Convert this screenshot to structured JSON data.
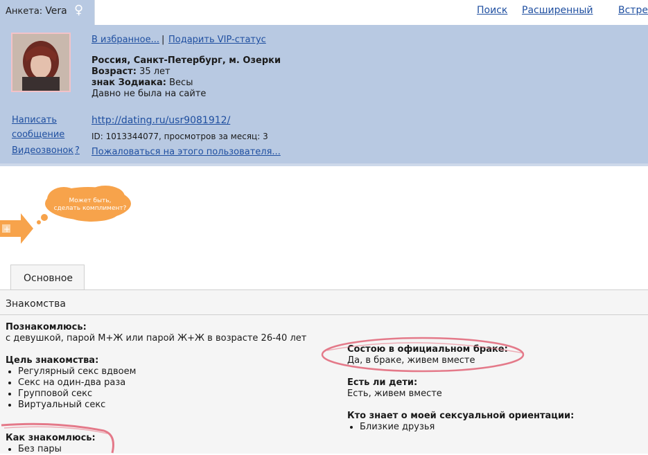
{
  "top": {
    "tab_prefix": "Анкета:",
    "tab_name": "Vera",
    "nav": [
      "Поиск",
      "Расширенный",
      "Встре"
    ]
  },
  "profile": {
    "fav_link": "В избранное...",
    "separator": "|",
    "vip_link": "Подарить VIP-статус",
    "location": "Россия, Санкт-Петербург, м. Озерки",
    "age_label": "Возраст:",
    "age_value": "35 лет",
    "zodiac_label": "знак Зодиака:",
    "zodiac_value": "Весы",
    "last_seen": "Давно не была на сайте",
    "write_1": "Написать",
    "write_2": "сообщение",
    "video": "Видеозвонок",
    "video_help": "?",
    "url": "http://dating.ru/usr9081912/",
    "id_line": "ID: 1013344077, просмотров за месяц: 3",
    "complain": "Пожаловаться на этого пользователя..."
  },
  "compliment": {
    "line1": "Может быть,",
    "line2": "сделать комплимент?"
  },
  "tabs": {
    "main": "Основное"
  },
  "section": {
    "title": "Знакомства",
    "meet_label": "Познакомлюсь:",
    "meet_value": "с девушкой, парой М+Ж или парой Ж+Ж в возрасте 26-40 лет",
    "goal_label": "Цель знакомства:",
    "goals": [
      "Регулярный секс вдвоем",
      "Секс на один-два раза",
      "Групповой секс",
      "Виртуальный секс"
    ],
    "how_label": "Как знакомлюсь:",
    "how": [
      "Без пары"
    ],
    "marriage_label": "Состою в официальном браке:",
    "marriage_value": "Да, в браке, живем вместе",
    "kids_label": "Есть ли дети:",
    "kids_value": "Есть, живем вместе",
    "orient_label": "Кто знает о моей сексуальной ориентации:",
    "orient": [
      "Близкие друзья"
    ]
  }
}
